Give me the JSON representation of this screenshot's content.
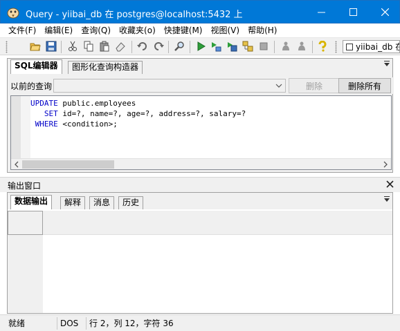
{
  "window": {
    "title": "Query - yiibai_db 在  postgres@localhost:5432 上",
    "app_icon": "elephant-icon"
  },
  "menu": [
    {
      "label": "文件(F)"
    },
    {
      "label": "编辑(E)"
    },
    {
      "label": "查询(Q)"
    },
    {
      "label": "收藏夹(o)"
    },
    {
      "label": "快捷键(M)"
    },
    {
      "label": "视图(V)"
    },
    {
      "label": "帮助(H)"
    }
  ],
  "toolbar": {
    "database_selector": "yiibai_db 在"
  },
  "top_tabs": [
    {
      "label": "SQL编辑器",
      "active": true
    },
    {
      "label": "图形化查询构造器",
      "active": false
    }
  ],
  "previous_query": {
    "label": "以前的查询",
    "value": "",
    "delete_label": "删除",
    "delete_all_label": "删除所有"
  },
  "editor": {
    "lines": [
      {
        "kw": "UPDATE",
        "text": " public.employees"
      },
      {
        "kw": "SET",
        "text": " id=?, name=?, age=?, address=?, salary=?"
      },
      {
        "kw": "WHERE",
        "text": " <condition>;"
      }
    ]
  },
  "output": {
    "title": "输出窗口",
    "tabs": [
      {
        "label": "数据输出",
        "active": true
      },
      {
        "label": "解释",
        "active": false
      },
      {
        "label": "消息",
        "active": false
      },
      {
        "label": "历史",
        "active": false
      }
    ]
  },
  "status": {
    "state": "就绪",
    "encoding": "DOS",
    "position": "行 2，列 12，字符 36"
  },
  "colors": {
    "titlebar": "#0078d7",
    "keyword": "#0000c8"
  }
}
